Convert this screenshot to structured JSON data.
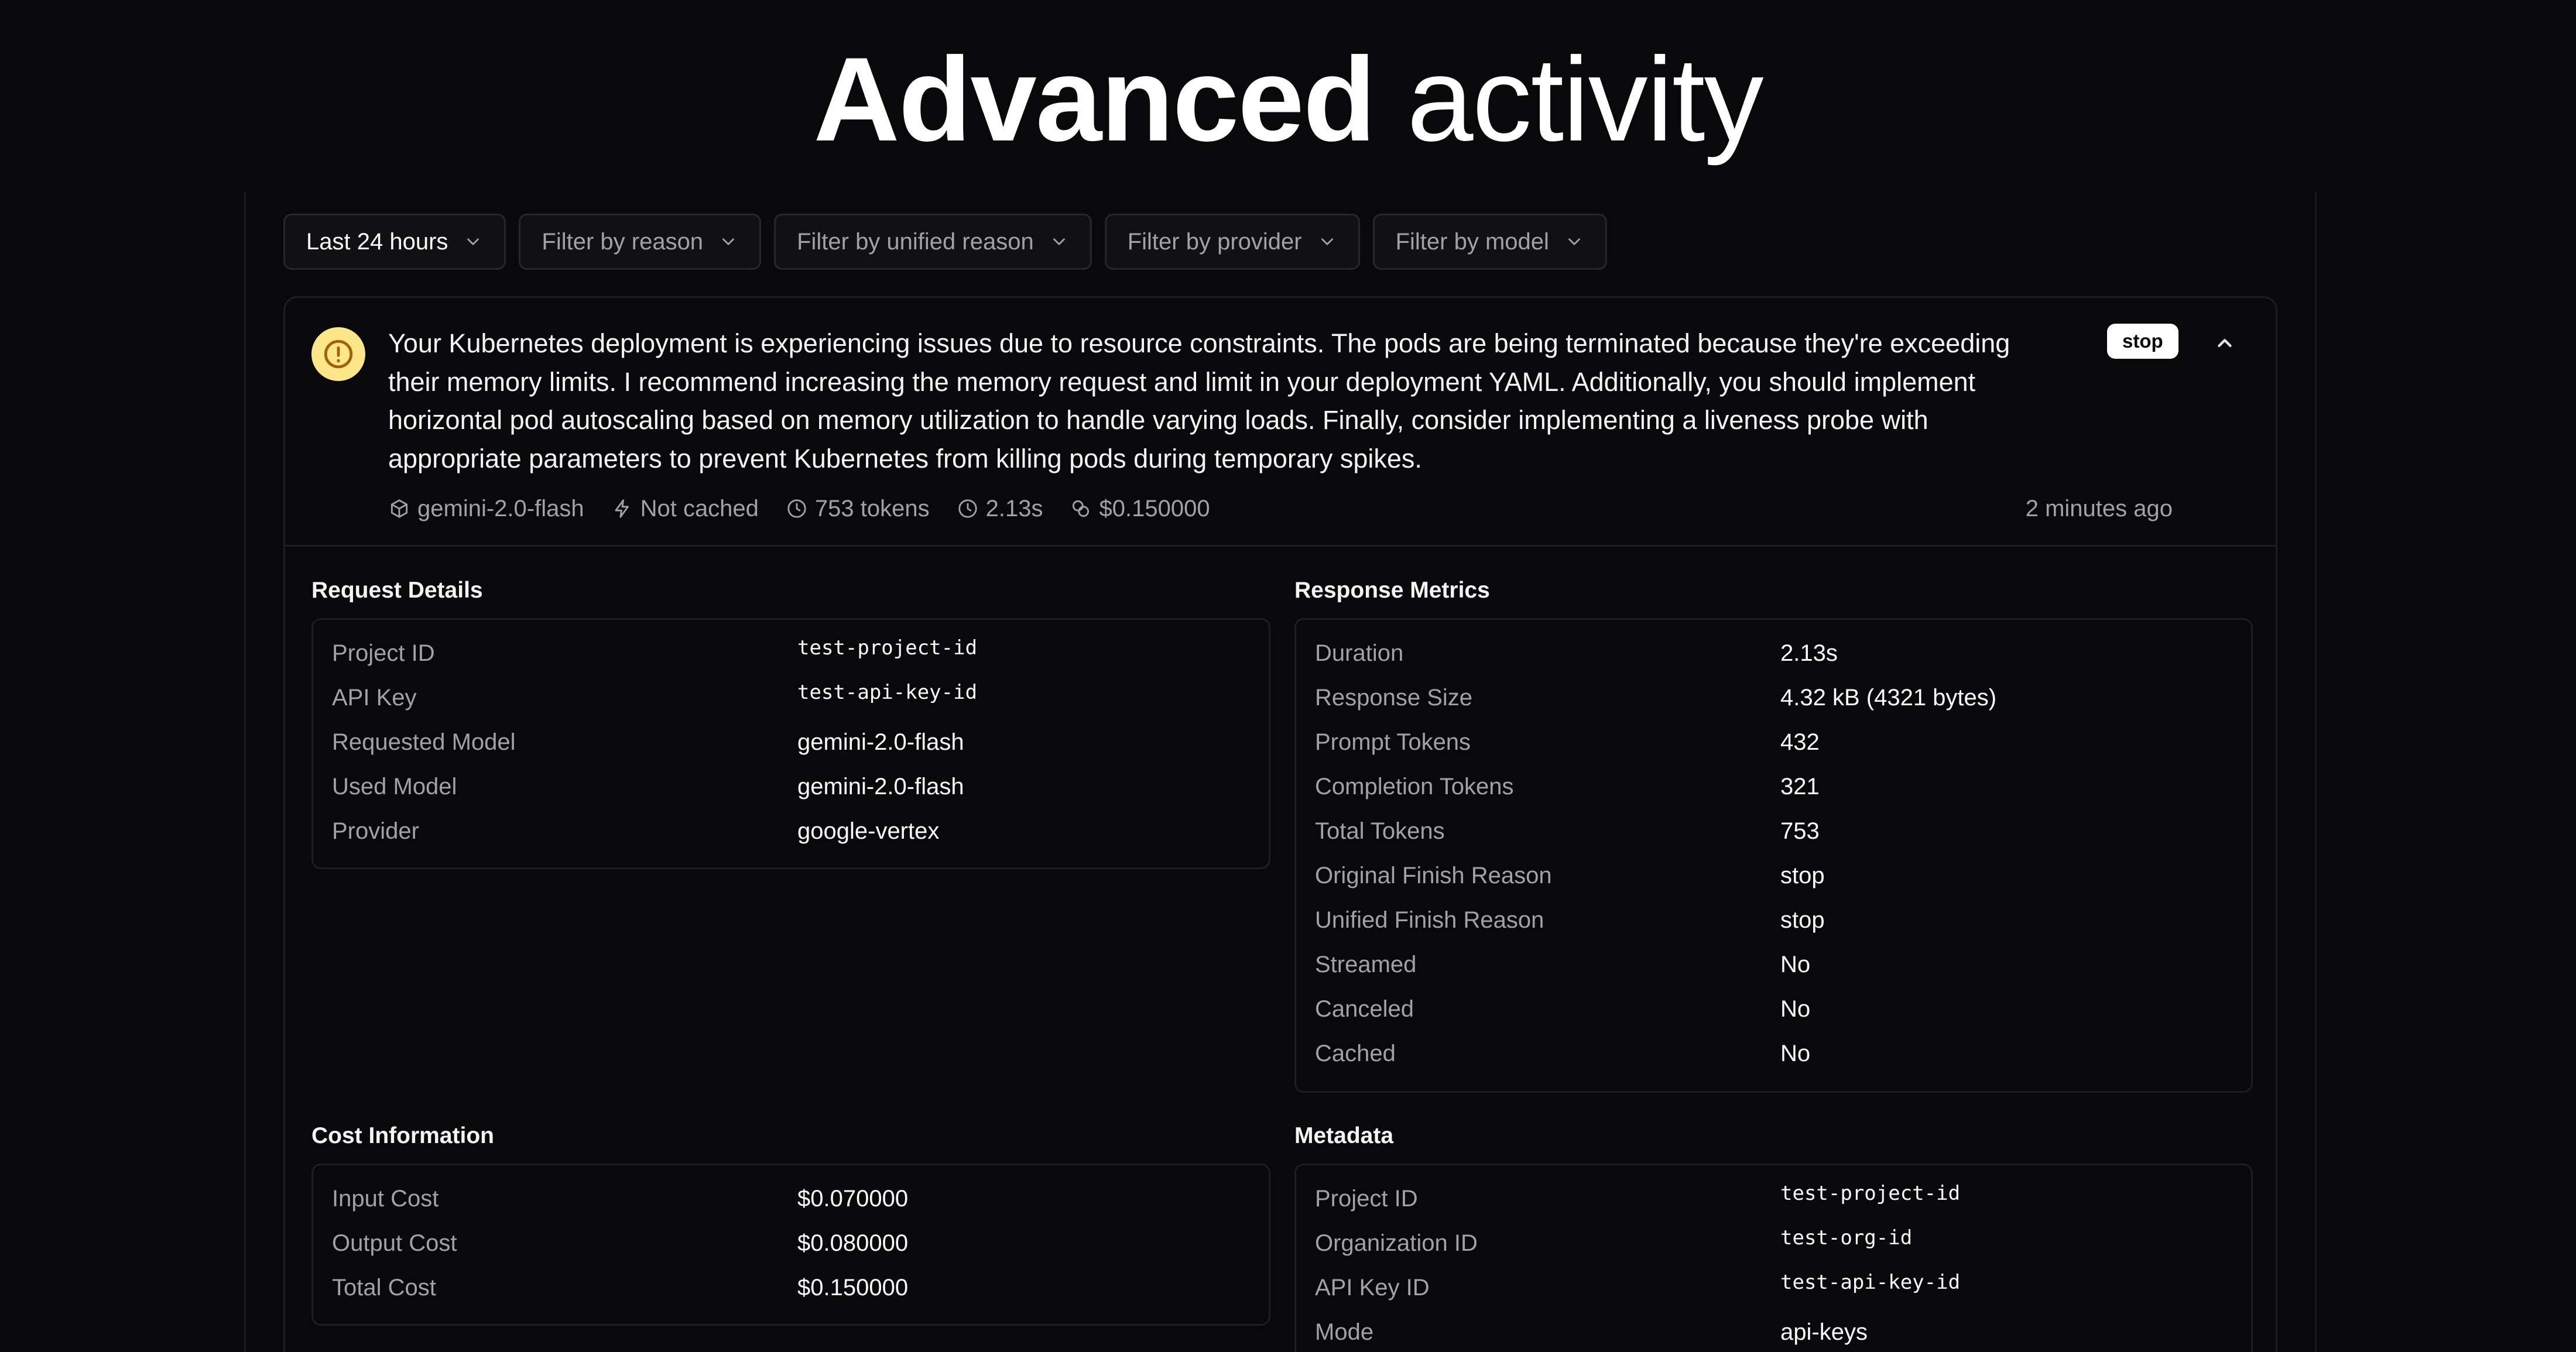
{
  "page": {
    "title_strong": "Advanced",
    "title_light": "activity"
  },
  "filters": [
    {
      "label": "Last 24 hours"
    },
    {
      "label": "Filter by reason"
    },
    {
      "label": "Filter by unified reason"
    },
    {
      "label": "Filter by provider"
    },
    {
      "label": "Filter by model"
    }
  ],
  "log": {
    "message": "Your Kubernetes deployment is experiencing issues due to resource constraints. The pods are being terminated because they're exceeding their memory limits. I recommend increasing the memory request and limit in your deployment YAML. Additionally, you should implement horizontal pod autoscaling based on memory utilization to handle varying loads. Finally, consider implementing a liveness probe with appropriate parameters to prevent Kubernetes from killing pods during temporary spikes.",
    "badge": "stop",
    "model": "gemini-2.0-flash",
    "cache_status": "Not cached",
    "tokens": "753 tokens",
    "duration": "2.13s",
    "cost": "$0.150000",
    "time_ago": "2 minutes ago",
    "status_color": "#fde68a"
  },
  "request_details": {
    "title": "Request Details",
    "rows": [
      {
        "key": "Project ID",
        "value": "test-project-id"
      },
      {
        "key": "API Key",
        "value": "test-api-key-id"
      },
      {
        "key": "Requested Model",
        "value": "gemini-2.0-flash"
      },
      {
        "key": "Used Model",
        "value": "gemini-2.0-flash"
      },
      {
        "key": "Provider",
        "value": "google-vertex"
      }
    ]
  },
  "response_metrics": {
    "title": "Response Metrics",
    "rows": [
      {
        "key": "Duration",
        "value": "2.13s"
      },
      {
        "key": "Response Size",
        "value": "4.32 kB (4321 bytes)"
      },
      {
        "key": "Prompt Tokens",
        "value": "432"
      },
      {
        "key": "Completion Tokens",
        "value": "321"
      },
      {
        "key": "Total Tokens",
        "value": "753"
      },
      {
        "key": "Original Finish Reason",
        "value": "stop"
      },
      {
        "key": "Unified Finish Reason",
        "value": "stop"
      },
      {
        "key": "Streamed",
        "value": "No"
      },
      {
        "key": "Canceled",
        "value": "No"
      },
      {
        "key": "Cached",
        "value": "No"
      }
    ]
  },
  "cost_information": {
    "title": "Cost Information",
    "rows": [
      {
        "key": "Input Cost",
        "value": "$0.070000"
      },
      {
        "key": "Output Cost",
        "value": "$0.080000"
      },
      {
        "key": "Total Cost",
        "value": "$0.150000"
      }
    ]
  },
  "metadata": {
    "title": "Metadata",
    "rows": [
      {
        "key": "Project ID",
        "value": "test-project-id"
      },
      {
        "key": "Organization ID",
        "value": "test-org-id"
      },
      {
        "key": "API Key ID",
        "value": "test-api-key-id"
      },
      {
        "key": "Mode",
        "value": "api-keys"
      }
    ]
  }
}
